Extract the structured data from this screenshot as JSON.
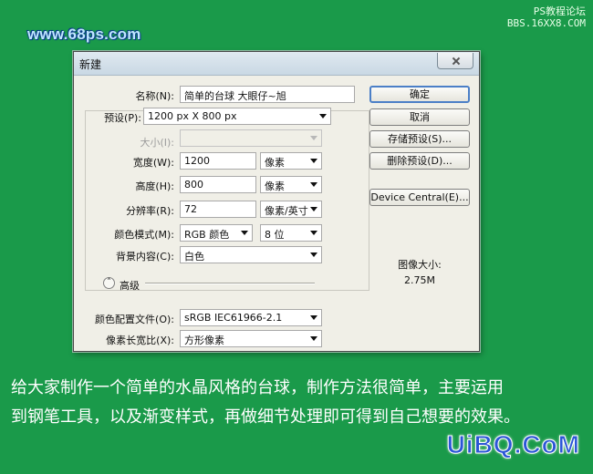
{
  "watermarks": {
    "site": "www.68ps.com",
    "forum_name": "PS教程论坛",
    "forum_url": "BBS.16XX8.COM",
    "brand": "UiBQ.CoM"
  },
  "dialog": {
    "title": "新建",
    "fields": {
      "name_label": "名称(N):",
      "name_value": "简单的台球  大眼仔~旭",
      "preset_label": "预设(P):",
      "preset_value": "1200 px X 800 px",
      "size_label": "大小(I):",
      "size_value": "",
      "width_label": "宽度(W):",
      "width_value": "1200",
      "width_unit": "像素",
      "height_label": "高度(H):",
      "height_value": "800",
      "height_unit": "像素",
      "resolution_label": "分辨率(R):",
      "resolution_value": "72",
      "resolution_unit": "像素/英寸",
      "color_mode_label": "颜色模式(M):",
      "color_mode_value": "RGB 颜色",
      "bit_depth_value": "8 位",
      "background_label": "背景内容(C):",
      "background_value": "白色",
      "advanced_label": "高级",
      "color_profile_label": "颜色配置文件(O):",
      "color_profile_value": "sRGB IEC61966-2.1",
      "pixel_aspect_label": "像素长宽比(X):",
      "pixel_aspect_value": "方形像素"
    },
    "buttons": {
      "ok": "确定",
      "cancel": "取消",
      "save_preset": "存储预设(S)...",
      "delete_preset": "删除预设(D)...",
      "device_central": "Device Central(E)..."
    },
    "image_size": {
      "label": "图像大小:",
      "value": "2.75M"
    }
  },
  "caption": {
    "line1": "给大家制作一个简单的水晶风格的台球，制作方法很简单，主要运用",
    "line2": "到钢笔工具，以及渐变样式，再做细节处理即可得到自己想要的效果。"
  }
}
